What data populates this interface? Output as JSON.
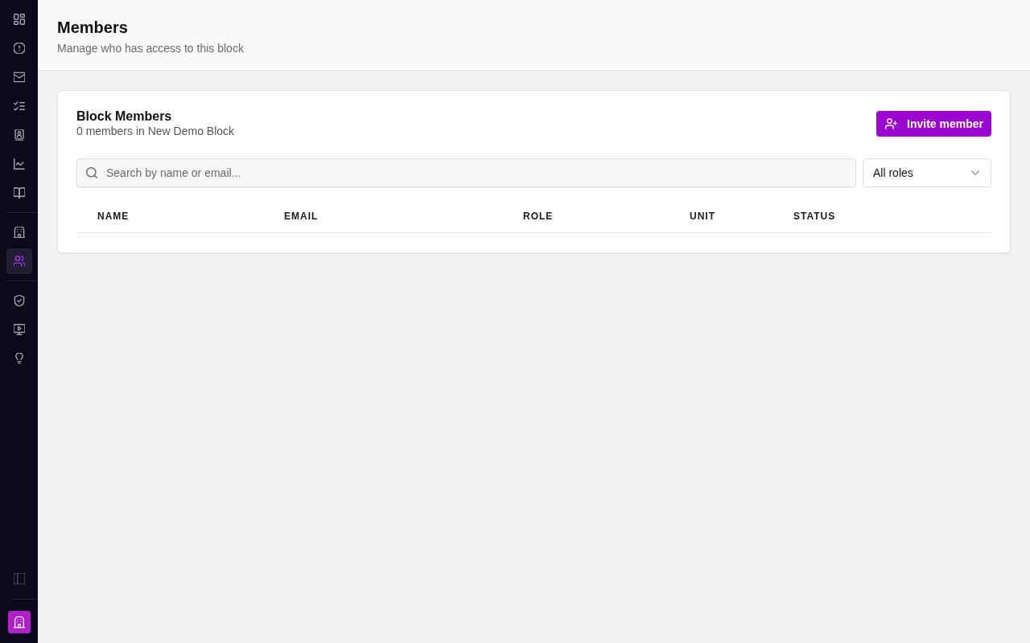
{
  "sidebar": {
    "groups": [
      {
        "items": [
          {
            "selected": false
          },
          {
            "selected": false
          },
          {
            "selected": false
          },
          {
            "selected": false
          },
          {
            "selected": false
          },
          {
            "selected": false
          },
          {
            "selected": false
          }
        ]
      },
      {
        "items": [
          {
            "selected": false
          },
          {
            "selected": true
          }
        ]
      },
      {
        "items": [
          {
            "selected": false
          },
          {
            "selected": false
          },
          {
            "selected": false
          }
        ]
      }
    ]
  },
  "header": {
    "title": "Members",
    "subtitle": "Manage who has access to this block"
  },
  "card": {
    "title": "Block Members",
    "subtitle": "0 members in New Demo Block",
    "invite_button": "Invite member",
    "search": {
      "placeholder": "Search by name or email..."
    },
    "role_filter": {
      "value": "All roles"
    },
    "table": {
      "columns": [
        "NAME",
        "EMAIL",
        "ROLE",
        "UNIT",
        "STATUS"
      ]
    }
  }
}
